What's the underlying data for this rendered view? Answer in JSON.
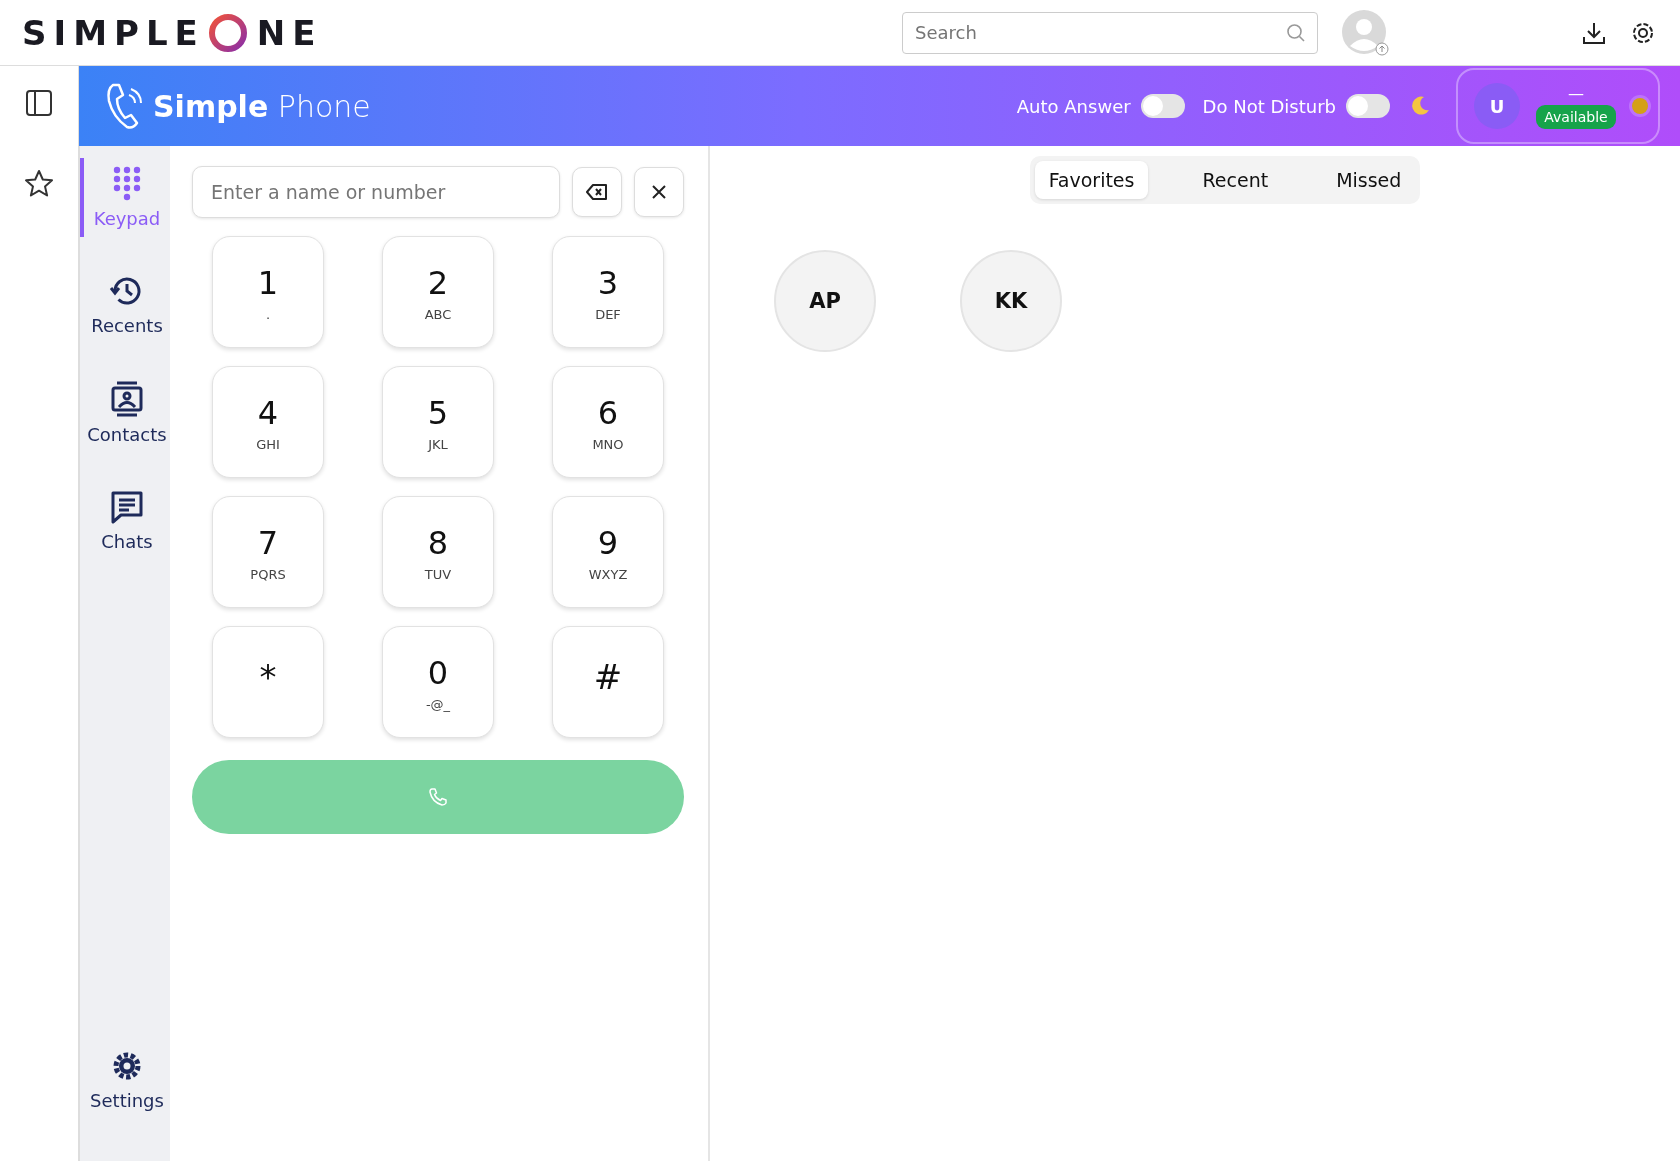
{
  "top_bar": {
    "logo_left": "SIMPLE",
    "logo_right": "NE",
    "search": {
      "placeholder": "Search"
    }
  },
  "phone_header": {
    "title_bold": "Simple",
    "title_light": "Phone",
    "toggles": [
      {
        "label": "Auto Answer",
        "on": false
      },
      {
        "label": "Do Not Disturb",
        "on": false
      }
    ],
    "profile": {
      "initial": "U",
      "name": "—",
      "status": "Available"
    }
  },
  "nav": [
    {
      "label": "Keypad",
      "selected": true
    },
    {
      "label": "Recents",
      "selected": false
    },
    {
      "label": "Contacts",
      "selected": false
    },
    {
      "label": "Chats",
      "selected": false
    }
  ],
  "nav_bottom": {
    "label": "Settings"
  },
  "dialer": {
    "placeholder": "Enter a name or number",
    "keys": [
      {
        "digit": "1",
        "letters": "."
      },
      {
        "digit": "2",
        "letters": "ABC"
      },
      {
        "digit": "3",
        "letters": "DEF"
      },
      {
        "digit": "4",
        "letters": "GHI"
      },
      {
        "digit": "5",
        "letters": "JKL"
      },
      {
        "digit": "6",
        "letters": "MNO"
      },
      {
        "digit": "7",
        "letters": "PQRS"
      },
      {
        "digit": "8",
        "letters": "TUV"
      },
      {
        "digit": "9",
        "letters": "WXYZ"
      },
      {
        "digit": "*"
      },
      {
        "digit": "0",
        "letters": "-@_"
      },
      {
        "digit": "#"
      }
    ]
  },
  "tabs": [
    {
      "label": "Favorites",
      "selected": true
    },
    {
      "label": "Recent",
      "selected": false
    },
    {
      "label": "Missed",
      "selected": false
    }
  ],
  "favorites": [
    {
      "initials": "AP"
    },
    {
      "initials": "KK"
    }
  ]
}
